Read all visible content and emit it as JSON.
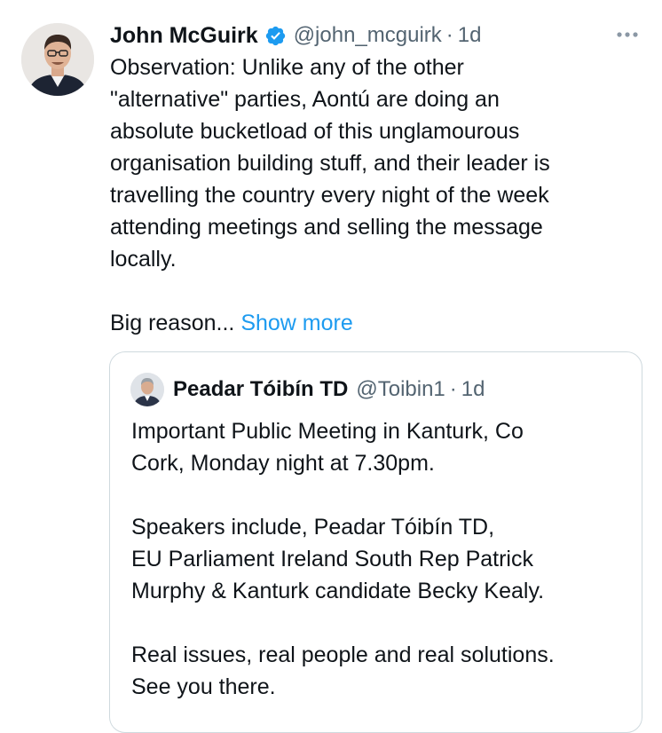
{
  "tweet": {
    "author_name": "John McGuirk",
    "verified_icon": "verified-badge-icon",
    "handle": "@john_mcguirk",
    "separator": "·",
    "time": "1d",
    "more_icon": "more-options-icon",
    "body_lines": [
      "Observation: Unlike any of the other",
      "\"alternative\" parties, Aontú are doing an",
      "absolute bucketload of this unglamourous",
      "organisation building stuff, and their leader is",
      "travelling the country every night of the week",
      "attending meetings and selling the message",
      "locally."
    ],
    "truncated_text": "Big reason...",
    "show_more": "Show more"
  },
  "quote": {
    "author_name": "Peadar Tóibín TD",
    "handle": "@Toibin1",
    "separator": "·",
    "time": "1d",
    "body_lines": [
      "Important Public Meeting in Kanturk, Co",
      "Cork, Monday night at 7.30pm.",
      "",
      "Speakers include, Peadar Tóibín TD,",
      "EU Parliament Ireland South Rep Patrick",
      "Murphy & Kanturk candidate Becky Kealy.",
      "",
      "Real issues, real people and real solutions.",
      "See you there."
    ]
  },
  "colors": {
    "text": "#0f1419",
    "secondary": "#536471",
    "link": "#1d9bf0",
    "verified": "#1d9bf0",
    "border": "#cfd9de"
  }
}
